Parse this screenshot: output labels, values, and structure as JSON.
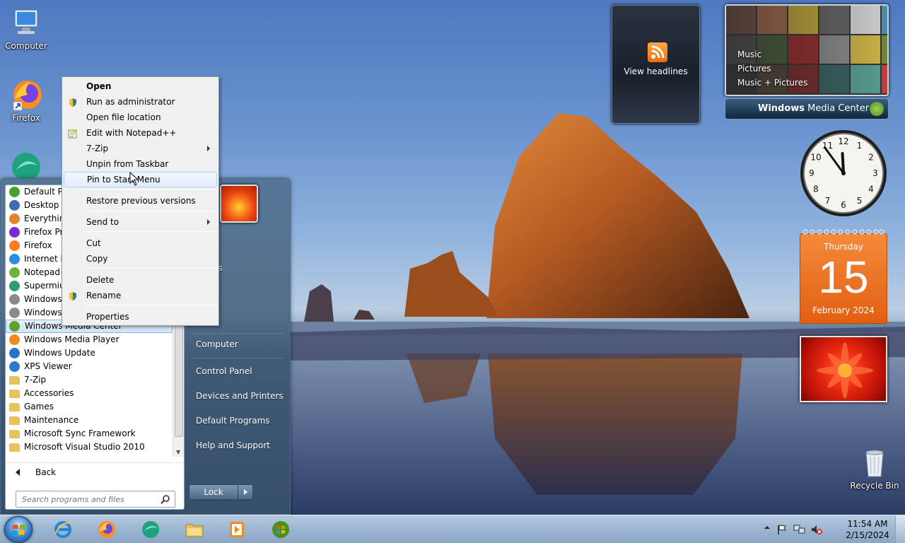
{
  "desktop": {
    "icons": [
      {
        "label": "Computer",
        "icon": "computer-icon"
      },
      {
        "label": "Firefox",
        "icon": "firefox-icon"
      },
      {
        "label": "",
        "icon": "teams-icon"
      },
      {
        "label": "Recycle Bin",
        "icon": "recycle-bin-icon"
      }
    ]
  },
  "start_menu": {
    "programs": [
      {
        "label": "Default Pro",
        "icon": "default-programs-icon",
        "color": "#4aa02c"
      },
      {
        "label": "Desktop G",
        "icon": "desktop-gadgets-icon",
        "color": "#3b6fb5"
      },
      {
        "label": "Everything",
        "icon": "everything-search-icon",
        "color": "#e0852a"
      },
      {
        "label": "Firefox Priv",
        "icon": "firefox-private-icon",
        "color": "#7b2bd1"
      },
      {
        "label": "Firefox",
        "icon": "firefox-icon",
        "color": "#ff7b1f"
      },
      {
        "label": "Internet Ex",
        "icon": "internet-explorer-icon",
        "color": "#2a8ee0"
      },
      {
        "label": "Notepad+",
        "icon": "notepadpp-icon",
        "color": "#6bb33c"
      },
      {
        "label": "Supermium",
        "icon": "supermium-icon",
        "color": "#2f9b6f"
      },
      {
        "label": "Windows I",
        "icon": "windows-icon",
        "color": "#8a8a8a"
      },
      {
        "label": "Windows I",
        "icon": "windows-icon",
        "color": "#8a8a8a"
      },
      {
        "label": "Windows Media Center",
        "icon": "media-center-icon",
        "color": "#5ca12e",
        "selected": true
      },
      {
        "label": "Windows Media Player",
        "icon": "media-player-icon",
        "color": "#f08a1c"
      },
      {
        "label": "Windows Update",
        "icon": "windows-update-icon",
        "color": "#2f72c4"
      },
      {
        "label": "XPS Viewer",
        "icon": "xps-viewer-icon",
        "color": "#2b7ad0"
      },
      {
        "label": "7-Zip",
        "icon": "folder-icon",
        "color": "#e8c25a"
      },
      {
        "label": "Accessories",
        "icon": "folder-icon",
        "color": "#e8c25a"
      },
      {
        "label": "Games",
        "icon": "folder-icon",
        "color": "#e8c25a"
      },
      {
        "label": "Maintenance",
        "icon": "folder-icon",
        "color": "#e8c25a"
      },
      {
        "label": "Microsoft Sync Framework",
        "icon": "folder-icon",
        "color": "#e8c25a"
      },
      {
        "label": "Microsoft Visual Studio 2010",
        "icon": "folder-icon",
        "color": "#e8c25a"
      }
    ],
    "back_label": "Back",
    "search_placeholder": "Search programs and files",
    "right_links": [
      {
        "label": "ments"
      },
      {
        "label": "es"
      },
      {
        "label": "Computer"
      },
      {
        "label": "Control Panel"
      },
      {
        "label": "Devices and Printers"
      },
      {
        "label": "Default Programs"
      },
      {
        "label": "Help and Support"
      }
    ],
    "lock_label": "Lock"
  },
  "context_menu": {
    "items": [
      {
        "label": "Open",
        "bold": true
      },
      {
        "label": "Run as administrator",
        "icon": "uac-shield-icon"
      },
      {
        "label": "Open file location"
      },
      {
        "label": "Edit with Notepad++",
        "icon": "notepadpp-icon"
      },
      {
        "label": "7-Zip",
        "submenu": true
      },
      {
        "label": "Unpin from Taskbar"
      },
      {
        "label": "Pin to Start Menu",
        "hover": true
      },
      {
        "label": "Restore previous versions"
      },
      {
        "label": "Send to",
        "submenu": true
      },
      {
        "label": "Cut"
      },
      {
        "label": "Copy"
      },
      {
        "label": "Delete"
      },
      {
        "label": "Rename",
        "icon": "uac-shield-icon"
      },
      {
        "label": "Properties"
      }
    ]
  },
  "gadgets": {
    "feed": {
      "label": "View headlines"
    },
    "media_center": {
      "menu": [
        "Music",
        "Pictures",
        "Music + Pictures"
      ],
      "brand_bold": "Windows",
      "brand_rest": " Media Center"
    },
    "clock": {
      "hour": 11,
      "minute": 54
    },
    "calendar": {
      "day_name": "Thursday",
      "date": "15",
      "month_year": "February 2024"
    }
  },
  "taskbar": {
    "pinned": [
      {
        "icon": "internet-explorer-icon"
      },
      {
        "icon": "firefox-icon"
      },
      {
        "icon": "teams-icon"
      },
      {
        "icon": "file-explorer-icon"
      },
      {
        "icon": "media-player-icon"
      },
      {
        "icon": "media-center-icon"
      }
    ],
    "tray": {
      "time": "11:54 AM",
      "date": "2/15/2024"
    }
  },
  "colors": {
    "accent": "#3d7fc8",
    "calendar": "#e35f10"
  }
}
